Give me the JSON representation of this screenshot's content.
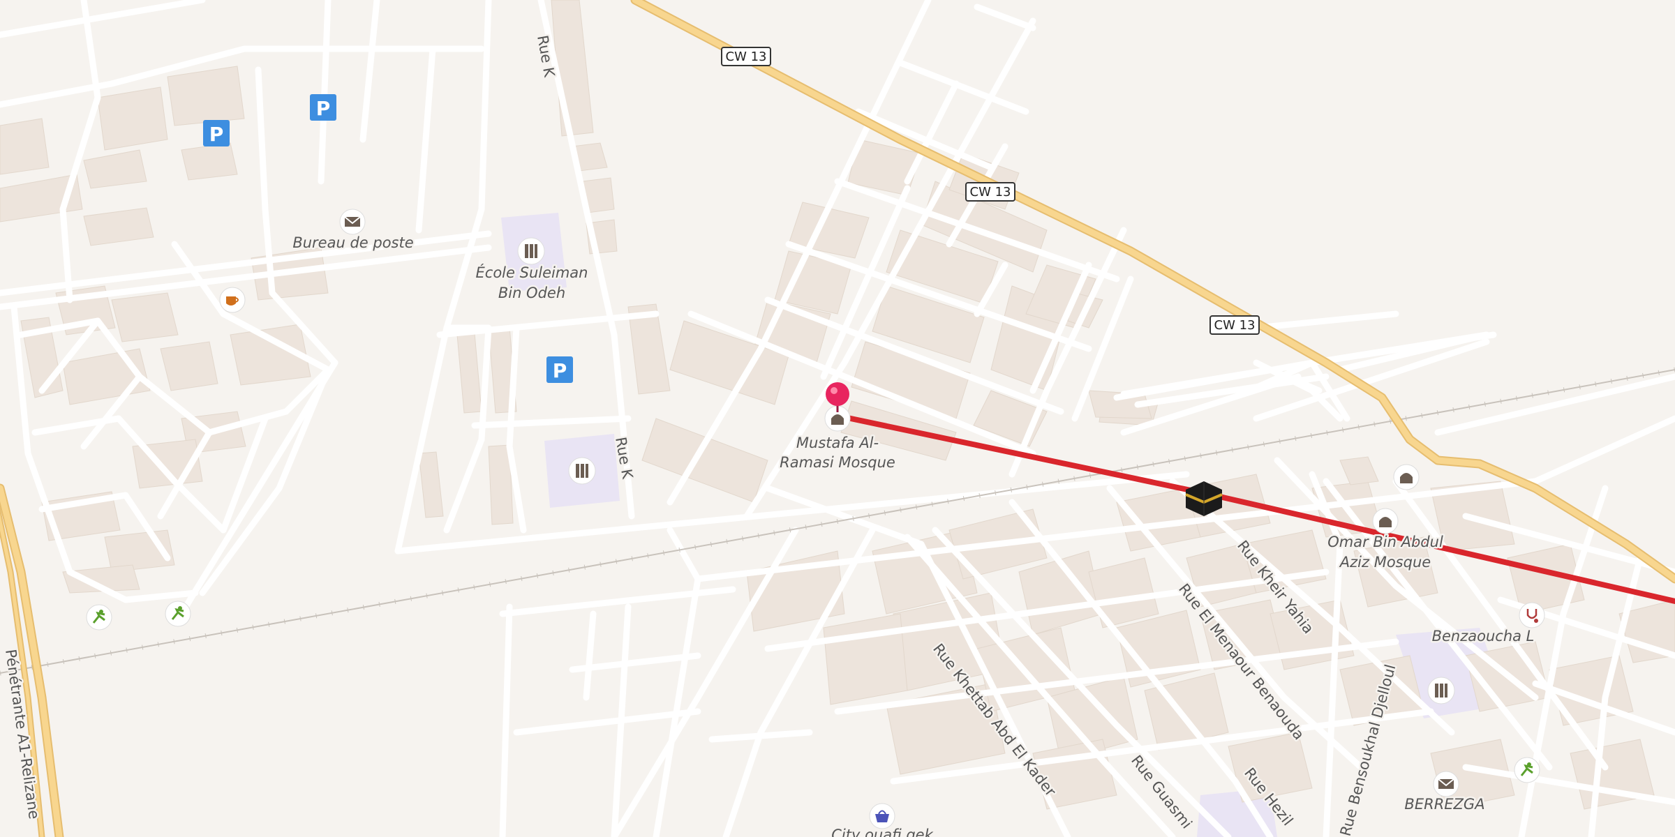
{
  "map": {
    "colors": {
      "background": "#f6f3ef",
      "building": "#ede4dc",
      "road": "#ffffff",
      "major_road": "#f8d68f",
      "school_area": "#e9e4f4",
      "route": "#d9262c",
      "pin": "#e8255f",
      "parking": "#3d8ee0"
    },
    "shields": [
      "CW 13",
      "CW 13",
      "CW 13"
    ],
    "streets": {
      "rue_k_1": "Rue K",
      "rue_k_2": "Rue K",
      "khettab": "Rue Khettab Abd El Kader",
      "menaour": "Rue El Menaour Benaouda",
      "kheir": "Rue Kheir Yahia",
      "guasmi": "Rue Guasmi",
      "hezil": "Rue Hezil",
      "bensoukhal": "Rue Bensoukhal Djelloul",
      "penetrante": "Pénétrante A1-Relizane"
    },
    "pois": {
      "bureau_poste": "Bureau de poste",
      "ecole_line1": "École Suleiman",
      "ecole_line2": "Bin Odeh",
      "mustafa_line1": "Mustafa Al-",
      "mustafa_line2": "Ramasi Mosque",
      "omar_line1": "Omar Bin Abdul",
      "omar_line2": "Aziz Mosque",
      "benzaoucha": "Benzaoucha L",
      "berrezga": "BERREZGA",
      "city_market": "City ouafi gek"
    },
    "icons": {
      "parking": "P",
      "mail": "mail-icon",
      "cafe": "cafe-icon",
      "school": "school-icon",
      "mosque": "mosque-icon",
      "kaaba": "kaaba-icon",
      "doctor": "stethoscope-icon",
      "sport": "sport-icon",
      "shop": "basket-icon",
      "pin": "pin-icon"
    }
  }
}
